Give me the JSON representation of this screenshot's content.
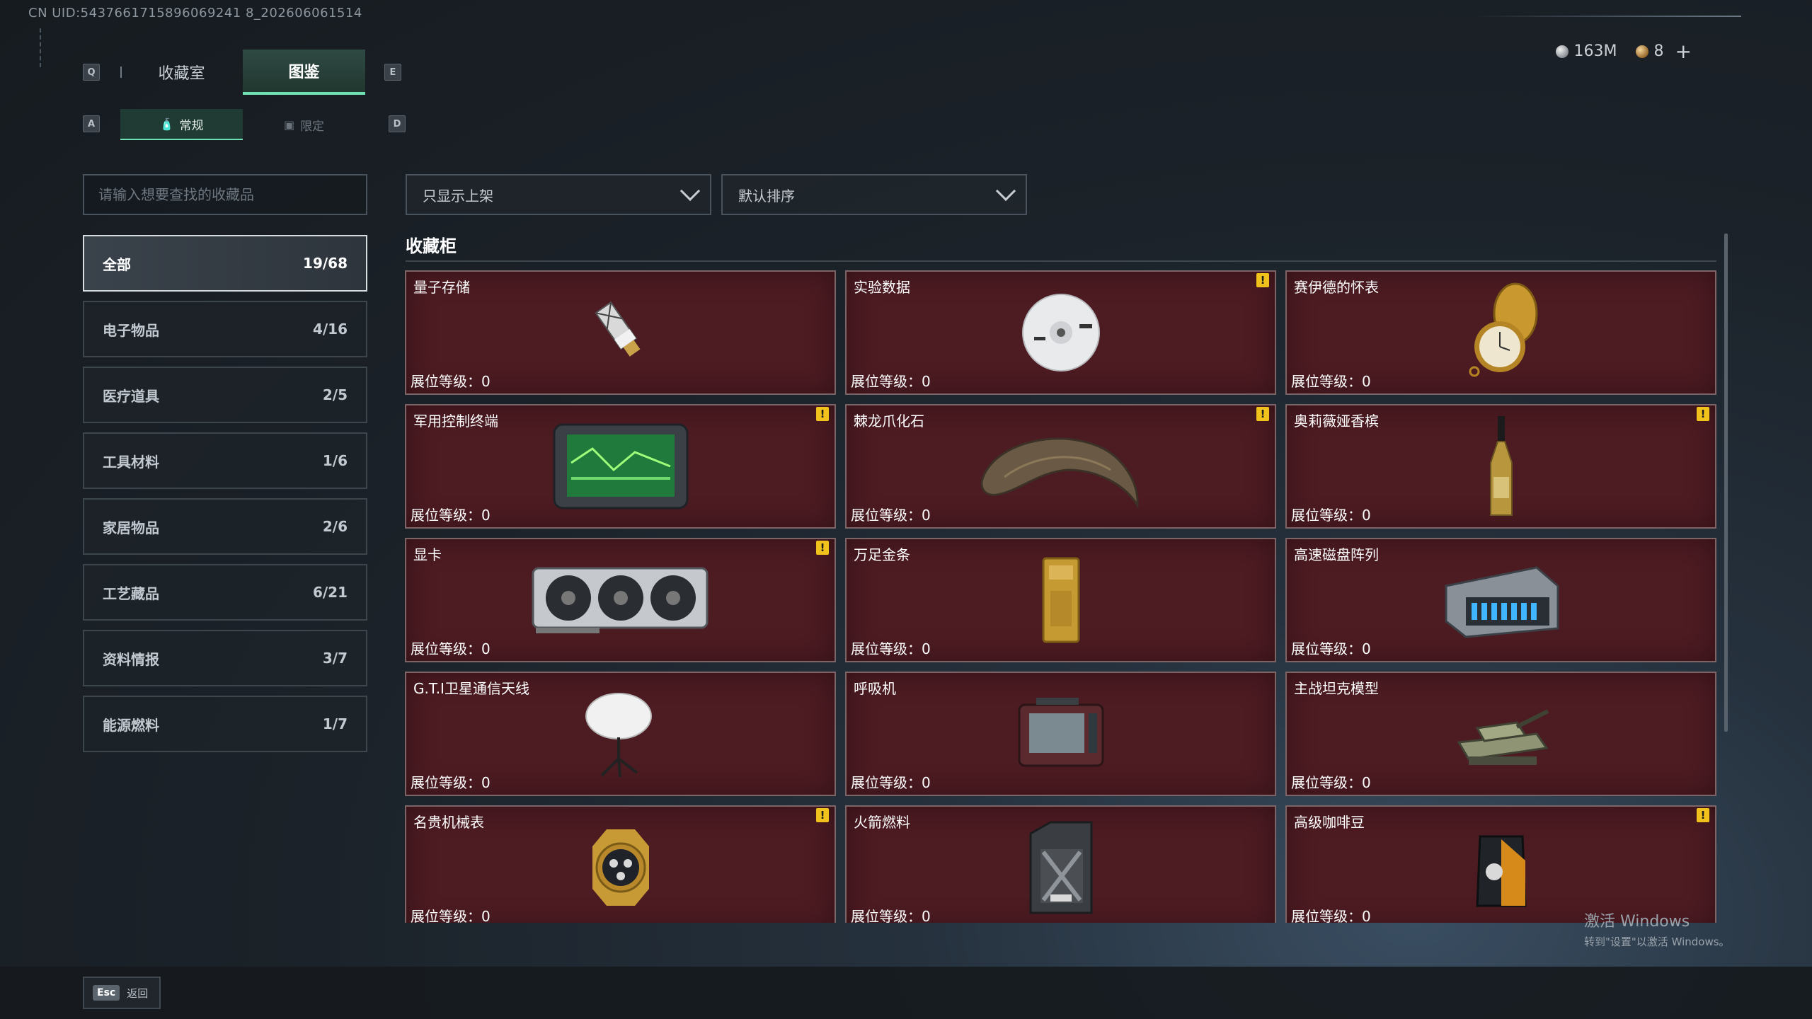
{
  "uid": "CN UID:5437661715896069241 8_202606061514",
  "currency": {
    "silver": "163M",
    "gold": "8",
    "plus": "+"
  },
  "keys": {
    "q": "Q",
    "e": "E",
    "a": "A",
    "d": "D"
  },
  "main_tabs": [
    {
      "label": "收藏室"
    },
    {
      "label": "图鉴"
    }
  ],
  "sub_tabs": [
    {
      "label": "常规",
      "icon": "🧴"
    },
    {
      "label": "限定",
      "icon": "▣"
    }
  ],
  "search": {
    "placeholder": "请输入想要查找的收藏品"
  },
  "filters": {
    "display_filter": "只显示上架",
    "sort": "默认排序"
  },
  "categories": [
    {
      "label": "全部",
      "count": "19/68"
    },
    {
      "label": "电子物品",
      "count": "4/16"
    },
    {
      "label": "医疗道具",
      "count": "2/5"
    },
    {
      "label": "工具材料",
      "count": "1/6"
    },
    {
      "label": "家居物品",
      "count": "2/6"
    },
    {
      "label": "工艺藏品",
      "count": "6/21"
    },
    {
      "label": "资料情报",
      "count": "3/7"
    },
    {
      "label": "能源燃料",
      "count": "1/7"
    }
  ],
  "section_title": "收藏柜",
  "items": [
    {
      "name": "量子存储",
      "level": "展位等级：0",
      "warn": false,
      "icon": "quantum-storage-icon"
    },
    {
      "name": "实验数据",
      "level": "展位等级：0",
      "warn": true,
      "icon": "disc-icon"
    },
    {
      "name": "赛伊德的怀表",
      "level": "展位等级：0",
      "warn": false,
      "icon": "pocket-watch-icon"
    },
    {
      "name": "军用控制终端",
      "level": "展位等级：0",
      "warn": true,
      "icon": "control-terminal-icon"
    },
    {
      "name": "棘龙爪化石",
      "level": "展位等级：0",
      "warn": true,
      "icon": "claw-fossil-icon"
    },
    {
      "name": "奥莉薇娅香槟",
      "level": "展位等级：0",
      "warn": true,
      "icon": "champagne-icon"
    },
    {
      "name": "显卡",
      "level": "展位等级：0",
      "warn": true,
      "icon": "graphics-card-icon"
    },
    {
      "name": "万足金条",
      "level": "展位等级：0",
      "warn": false,
      "icon": "gold-bar-icon"
    },
    {
      "name": "高速磁盘阵列",
      "level": "展位等级：0",
      "warn": false,
      "icon": "disk-array-icon"
    },
    {
      "name": "G.T.I卫星通信天线",
      "level": "展位等级：0",
      "warn": false,
      "icon": "satellite-dish-icon"
    },
    {
      "name": "呼吸机",
      "level": "展位等级：0",
      "warn": false,
      "icon": "ventilator-icon"
    },
    {
      "name": "主战坦克模型",
      "level": "展位等级：0",
      "warn": false,
      "icon": "tank-model-icon"
    },
    {
      "name": "名贵机械表",
      "level": "展位等级：0",
      "warn": true,
      "icon": "wristwatch-icon"
    },
    {
      "name": "火箭燃料",
      "level": "展位等级：0",
      "warn": false,
      "icon": "fuel-canister-icon"
    },
    {
      "name": "高级咖啡豆",
      "level": "展位等级：0",
      "warn": true,
      "icon": "coffee-bag-icon"
    }
  ],
  "warn_symbol": "!",
  "footer": {
    "esc_key": "Esc",
    "esc_label": "返回"
  },
  "watermark": {
    "title": "激活 Windows",
    "subtitle": "转到\"设置\"以激活 Windows。"
  },
  "colors": {
    "accent": "#6fe0b4",
    "card_bg": "#4d1b22",
    "warn": "#f1c21b"
  }
}
